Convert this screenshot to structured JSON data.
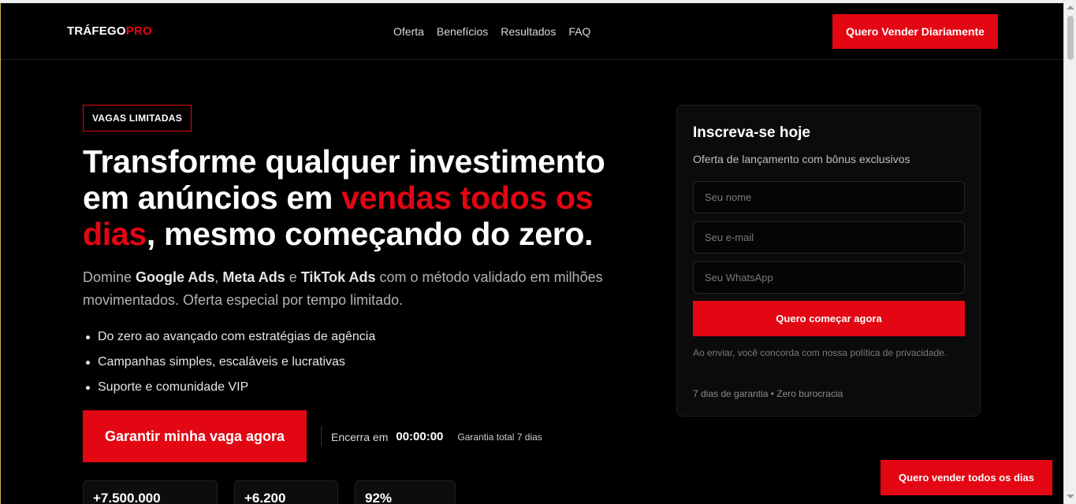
{
  "header": {
    "logo_main": "TRÁFEGO",
    "logo_accent": "PRO",
    "menu": [
      "Oferta",
      "Benefícios",
      "Resultados",
      "FAQ"
    ],
    "cta": "Quero Vender Diariamente"
  },
  "hero": {
    "badge": "VAGAS LIMITADAS",
    "headline_part1": "Transforme qualquer investimento em anúncios em ",
    "headline_highlight": "vendas todos os dias",
    "headline_part2": ", mesmo começando do zero.",
    "sub_intro": "Domine ",
    "sub_b1": "Google Ads",
    "sub_sep1": ", ",
    "sub_b2": "Meta Ads",
    "sub_sep2": " e ",
    "sub_b3": "TikTok Ads",
    "sub_rest": " com o método validado em milhões movimentados. Oferta especial por tempo limitado.",
    "bullets": [
      "Do zero ao avançado com estratégias de agência",
      "Campanhas simples, escaláveis e lucrativas",
      "Suporte e comunidade VIP"
    ],
    "cta": "Garantir minha vaga agora",
    "timer_label": "Encerra em",
    "timer_value": "00:00:00",
    "guarantee": "Garantia total 7 dias",
    "stats": [
      "+7.500.000",
      "+6.200",
      "92%"
    ]
  },
  "signup": {
    "title": "Inscreva-se hoje",
    "subtitle": "Oferta de lançamento com bônus exclusivos",
    "name_placeholder": "Seu nome",
    "email_placeholder": "Seu e-mail",
    "whatsapp_placeholder": "Seu WhatsApp",
    "submit": "Quero começar agora",
    "privacy": "Ao enviar, você concorda com nossa política de privacidade.",
    "footer": "7 dias de garantia • Zero burocracia"
  },
  "floating_cta": "Quero vender todos os dias",
  "colors": {
    "accent": "#e30613",
    "background": "#000000"
  }
}
